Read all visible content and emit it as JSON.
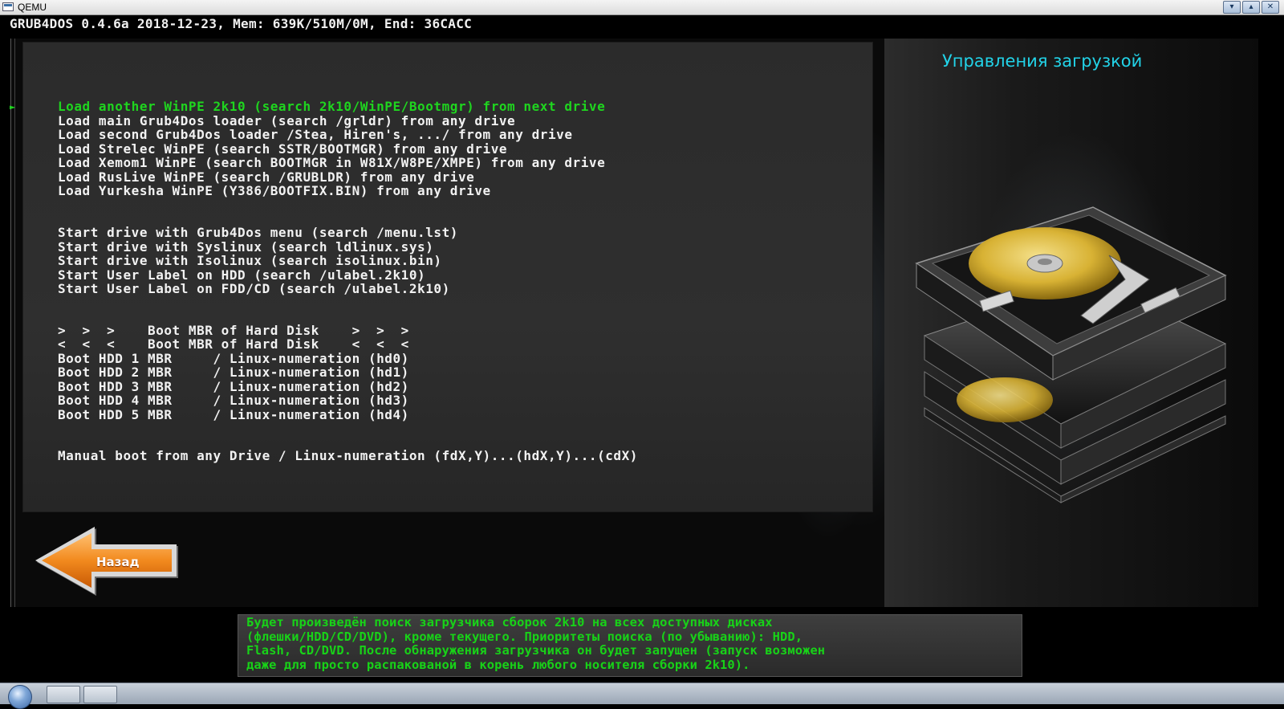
{
  "window": {
    "title": "QEMU",
    "buttons": [
      "minimize",
      "restore",
      "close"
    ]
  },
  "grub": {
    "header": "GRUB4DOS 0.4.6a 2018-12-23, Mem: 639K/510M/0M, End: 36CACC"
  },
  "panel": {
    "title": "Управления загрузкой"
  },
  "menu": {
    "selected_index": 0,
    "selector_glyph": "►",
    "items": [
      "Load another WinPE 2k10 (search 2k10/WinPE/Bootmgr) from next drive",
      "Load main Grub4Dos loader (search /grldr) from any drive",
      "Load second Grub4Dos loader /Stea, Hiren's, .../ from any drive",
      "Load Strelec WinPE (search SSTR/BOOTMGR) from any drive",
      "Load Xemom1 WinPE (search BOOTMGR in W81X/W8PE/XMPE) from any drive",
      "Load RusLive WinPE (search /GRUBLDR) from any drive",
      "Load Yurkesha WinPE (Y386/BOOTFIX.BIN) from any drive",
      "Start drive with Grub4Dos menu (search /menu.lst)",
      "Start drive with Syslinux (search ldlinux.sys)",
      "Start drive with Isolinux (search isolinux.bin)",
      "Start User Label on HDD (search /ulabel.2k10)",
      "Start User Label on FDD/CD (search /ulabel.2k10)",
      ">  >  >    Boot MBR of Hard Disk    >  >  >",
      "<  <  <    Boot MBR of Hard Disk    <  <  <",
      "Boot HDD 1 MBR     / Linux-numeration (hd0)",
      "Boot HDD 2 MBR     / Linux-numeration (hd1)",
      "Boot HDD 3 MBR     / Linux-numeration (hd2)",
      "Boot HDD 4 MBR     / Linux-numeration (hd3)",
      "Boot HDD 5 MBR     / Linux-numeration (hd4)",
      "Manual boot from any Drive / Linux-numeration (fdX,Y)...(hdX,Y)...(cdX)"
    ]
  },
  "back_button": {
    "label": "Назад"
  },
  "description": {
    "lines": [
      "Будет произведён поиск загрузчика сборок 2k10 на всех доступных дисках",
      "(флешки/HDD/CD/DVD), кроме текущего. Приоритеты поиска (по убыванию): HDD,",
      "Flash, CD/DVD. После обнаружения загрузчика он будет запущен (запуск возможен",
      "даже для просто распакованой в корень любого носителя сборки 2k10)."
    ]
  },
  "colors": {
    "selected": "#1fd51f",
    "text": "#f2f2f2",
    "title": "#22d3e8",
    "back_button": "#f28a1e"
  }
}
